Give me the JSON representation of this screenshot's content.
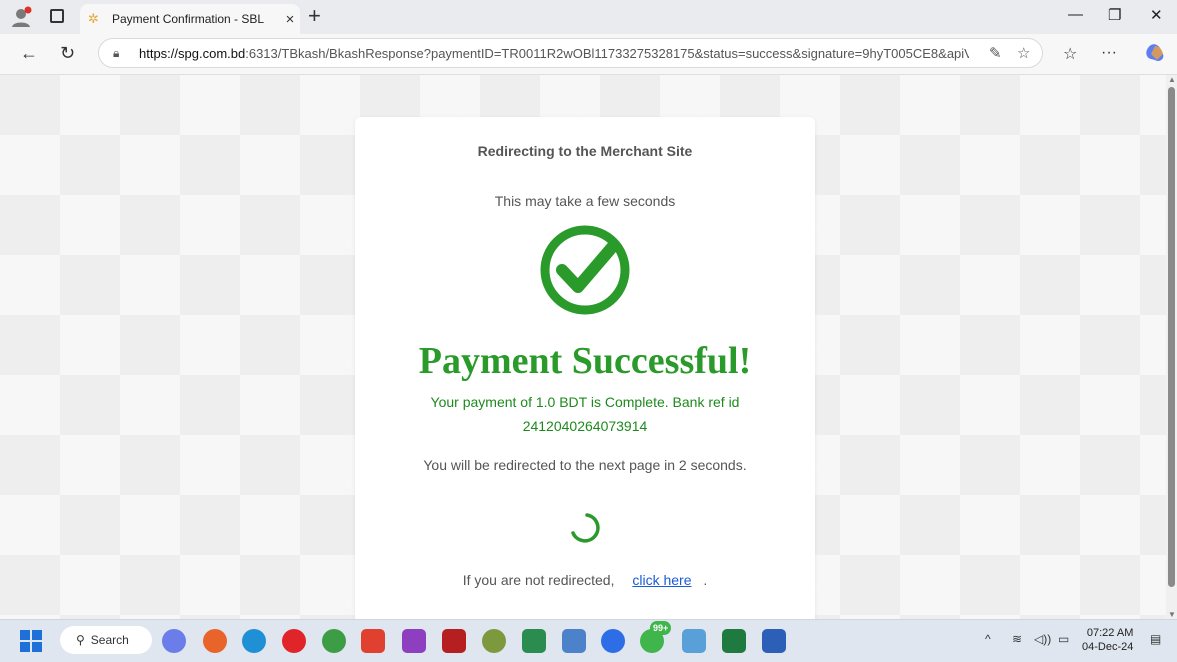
{
  "browser": {
    "tab_title": "Payment Confirmation - SBL",
    "url_host": "https://spg.com.bd",
    "url_rest": ":6313/TBkash/BkashResponse?paymentID=TR0011R2wOBl11733275328175&status=success&signature=9hyT005CE8&apiV...",
    "new_tab": "+",
    "close_tab": "×"
  },
  "page": {
    "heading": "Redirecting to the Merchant Site",
    "subheading": "This may take a few seconds",
    "success_title": "Payment Successful!",
    "message_line1": "Your payment of 1.0 BDT is Complete. Bank ref id",
    "message_line2": "2412040264073914",
    "redirect_text": "You will be redirected to the next page in 2 seconds.",
    "not_redirected": "If you are not redirected,",
    "click_here": "click here",
    "trailing": "."
  },
  "taskbar": {
    "search_label": "Search",
    "time": "07:22 AM",
    "date": "04-Dec-24",
    "badge": "99+"
  },
  "colors": {
    "success_green": "#2a9a2a",
    "link_blue": "#1a5bd6"
  }
}
